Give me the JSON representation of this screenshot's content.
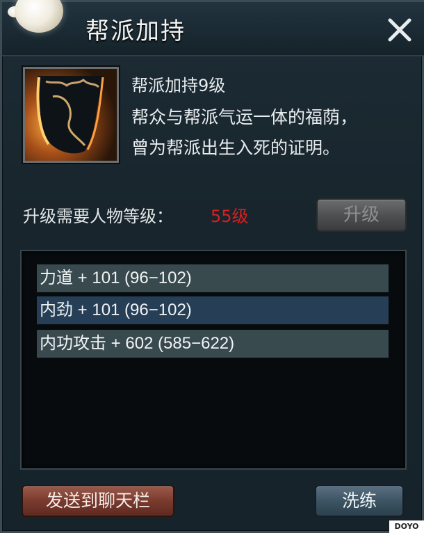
{
  "window": {
    "title": "帮派加持",
    "close_icon": "close-x-icon"
  },
  "skill": {
    "icon": "guild-banner-icon",
    "name": "帮派加持9级",
    "description_line1": "帮众与帮派气运一体的福荫，",
    "description_line2": "曾为帮派出生入死的证明。"
  },
  "requirement": {
    "label": "升级需要人物等级：",
    "value": "55级",
    "value_color": "#d92020"
  },
  "buttons": {
    "upgrade_label": "升级",
    "send_label": "发送到聊天栏",
    "refine_label": "洗练"
  },
  "attributes": [
    {
      "text": "力道 + 101 (96−102)"
    },
    {
      "text": "内劲 + 101 (96−102)"
    },
    {
      "text": "内功攻击 + 602 (585−622)"
    }
  ],
  "watermark": "DOYO"
}
